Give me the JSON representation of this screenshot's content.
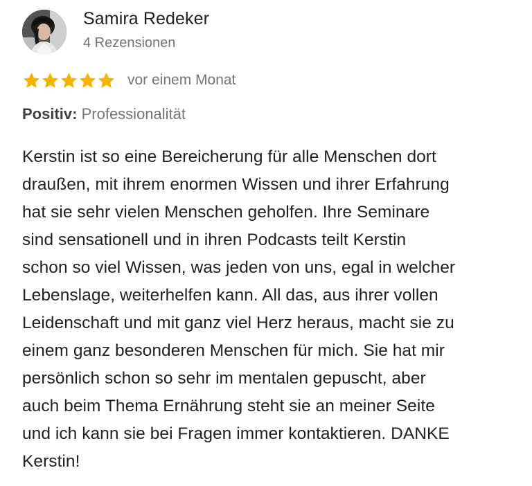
{
  "review": {
    "author": {
      "name": "Samira Redeker",
      "review_count": "4 Rezensionen",
      "avatar_icon": "user-avatar-photo"
    },
    "rating": {
      "stars": 5,
      "max_stars": 5,
      "star_color": "#f4b400",
      "date": "vor einem Monat"
    },
    "positive": {
      "label": "Positiv:",
      "value": "Professionalität"
    },
    "text": "Kerstin ist so eine Bereicherung für alle Menschen dort\ndraußen, mit ihrem enormen Wissen und ihrer Erfahrung\nhat sie sehr vielen Menschen geholfen. Ihre Seminare\nsind sensationell und in ihren Podcasts teilt Kerstin\nschon so viel Wissen, was jeden von uns, egal in welcher\nLebenslage, weiterhelfen kann. All das, aus ihrer vollen\nLeidenschaft und mit ganz viel Herz heraus, macht sie zu\neinem ganz besonderen Menschen für mich. Sie hat mir\npersönlich schon so sehr im mentalen gepuscht, aber\nauch beim Thema Ernährung steht sie an meiner Seite\nund ich kann sie bei Fragen immer kontaktieren. DANKE\nKerstin!"
  }
}
